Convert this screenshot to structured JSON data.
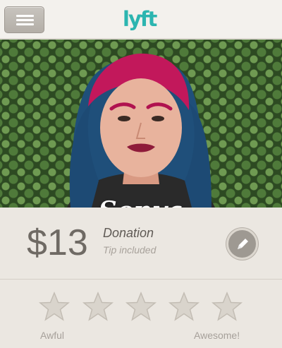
{
  "header": {
    "menu_icon": "hamburger-menu-icon",
    "logo_text": "lyft",
    "logo_color": "#2cb5b0"
  },
  "driver": {
    "name": "Sonya"
  },
  "fare": {
    "amount": "$13",
    "label": "Donation",
    "sublabel": "Tip included",
    "edit_icon": "pencil-icon"
  },
  "rating": {
    "stars": 5,
    "selected": 0,
    "low_label": "Awful",
    "high_label": "Awesome!"
  }
}
